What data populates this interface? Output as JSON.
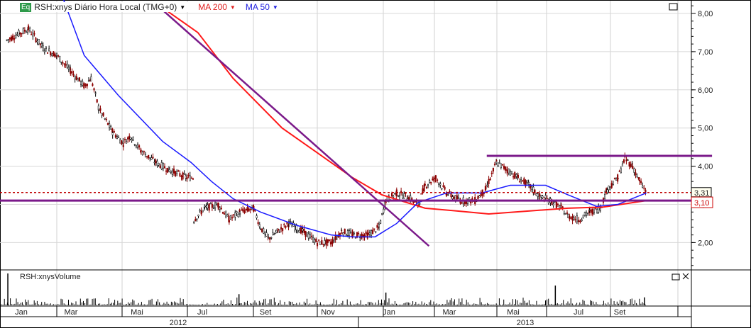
{
  "legend": {
    "badge": "Eq",
    "title": "RSH:xnys Diário Hora Local (TMG+0)",
    "ma200": "MA 200",
    "ma50": "MA 50",
    "dropdown_icon": "triangle-down"
  },
  "volume_panel": {
    "title": "RSH:xnysVolume"
  },
  "colors": {
    "ma200": "#ff1a1a",
    "ma50": "#1a1aff",
    "trendline": "#7b1a8a",
    "last_price": "#c00000",
    "candle_up": "#000000",
    "candle_down": "#8b0000"
  },
  "chart_data": {
    "type": "candlestick",
    "ylim": [
      1.3,
      8.35
    ],
    "yticks": [
      "8,00",
      "7,00",
      "6,00",
      "5,00",
      "4,00",
      "3,00",
      "2,00"
    ],
    "ytick_values": [
      8,
      7,
      6,
      5,
      4,
      3,
      2
    ],
    "months": [
      "Jan",
      "Mar",
      "Mai",
      "Jul",
      "Set",
      "Nov",
      "Jan",
      "Mar",
      "Mai",
      "Jul",
      "Set"
    ],
    "years": [
      "2012",
      "2013"
    ],
    "price": [
      [
        "2012-01-08",
        7.3
      ],
      [
        "2012-01-30",
        7.6
      ],
      [
        "2012-02-14",
        7.1
      ],
      [
        "2012-02-28",
        6.9
      ],
      [
        "2012-03-13",
        6.5
      ],
      [
        "2012-03-27",
        6.1
      ],
      [
        "2012-04-03",
        6.3
      ],
      [
        "2012-04-11",
        5.5
      ],
      [
        "2012-04-25",
        4.9
      ],
      [
        "2012-05-06",
        4.6
      ],
      [
        "2012-05-13",
        4.8
      ],
      [
        "2012-05-24",
        4.4
      ],
      [
        "2012-06-08",
        4.1
      ],
      [
        "2012-06-22",
        3.9
      ],
      [
        "2012-07-10",
        3.7
      ],
      [
        "2012-07-17",
        2.6
      ],
      [
        "2012-07-28",
        2.9
      ],
      [
        "2012-08-11",
        3.0
      ],
      [
        "2012-08-22",
        2.6
      ],
      [
        "2012-09-02",
        2.8
      ],
      [
        "2012-09-16",
        2.9
      ],
      [
        "2012-09-23",
        2.4
      ],
      [
        "2012-10-01",
        2.1
      ],
      [
        "2012-10-11",
        2.3
      ],
      [
        "2012-10-22",
        2.5
      ],
      [
        "2012-11-05",
        2.3
      ],
      [
        "2012-11-20",
        2.0
      ],
      [
        "2012-12-04",
        2.0
      ],
      [
        "2012-12-15",
        2.3
      ],
      [
        "2012-12-26",
        2.2
      ],
      [
        "2013-01-11",
        2.2
      ],
      [
        "2013-01-22",
        2.4
      ],
      [
        "2013-01-29",
        3.1
      ],
      [
        "2013-02-09",
        3.3
      ],
      [
        "2013-02-20",
        3.2
      ],
      [
        "2013-03-03",
        3.0
      ],
      [
        "2013-03-10",
        3.5
      ],
      [
        "2013-03-21",
        3.7
      ],
      [
        "2013-04-01",
        3.3
      ],
      [
        "2013-04-15",
        3.1
      ],
      [
        "2013-04-30",
        3.1
      ],
      [
        "2013-05-11",
        3.4
      ],
      [
        "2013-05-22",
        4.1
      ],
      [
        "2013-06-02",
        3.9
      ],
      [
        "2013-06-13",
        3.7
      ],
      [
        "2013-06-24",
        3.5
      ],
      [
        "2013-07-05",
        3.2
      ],
      [
        "2013-07-16",
        3.1
      ],
      [
        "2013-07-27",
        2.9
      ],
      [
        "2013-08-03",
        2.7
      ],
      [
        "2013-08-14",
        2.6
      ],
      [
        "2013-08-25",
        2.8
      ],
      [
        "2013-09-05",
        2.9
      ],
      [
        "2013-09-12",
        3.4
      ],
      [
        "2013-09-23",
        3.7
      ],
      [
        "2013-09-30",
        4.2
      ],
      [
        "2013-10-08",
        4.0
      ],
      [
        "2013-10-15",
        3.6
      ],
      [
        "2013-10-22",
        3.31
      ]
    ],
    "ma50": [
      [
        "2012-03-06",
        8.35
      ],
      [
        "2012-03-27",
        6.9
      ],
      [
        "2012-05-01",
        5.85
      ],
      [
        "2012-06-15",
        4.65
      ],
      [
        "2012-07-14",
        4.1
      ],
      [
        "2012-08-04",
        3.6
      ],
      [
        "2012-08-26",
        3.15
      ],
      [
        "2012-09-23",
        2.8
      ],
      [
        "2012-10-30",
        2.45
      ],
      [
        "2012-12-04",
        2.2
      ],
      [
        "2012-12-26",
        2.15
      ],
      [
        "2013-01-18",
        2.15
      ],
      [
        "2013-02-09",
        2.5
      ],
      [
        "2013-03-03",
        3.05
      ],
      [
        "2013-04-01",
        3.3
      ],
      [
        "2013-05-07",
        3.3
      ],
      [
        "2013-06-05",
        3.5
      ],
      [
        "2013-07-11",
        3.5
      ],
      [
        "2013-08-03",
        3.25
      ],
      [
        "2013-09-01",
        2.95
      ],
      [
        "2013-09-23",
        3.0
      ],
      [
        "2013-10-22",
        3.3
      ]
    ],
    "ma200": [
      [
        "2012-06-15",
        8.15
      ],
      [
        "2012-07-21",
        7.5
      ],
      [
        "2012-08-26",
        6.3
      ],
      [
        "2012-10-15",
        5.0
      ],
      [
        "2012-11-20",
        4.35
      ],
      [
        "2012-12-26",
        3.7
      ],
      [
        "2013-01-25",
        3.25
      ],
      [
        "2013-03-10",
        2.9
      ],
      [
        "2013-04-15",
        2.82
      ],
      [
        "2013-05-14",
        2.75
      ],
      [
        "2013-06-20",
        2.82
      ],
      [
        "2013-08-03",
        2.9
      ],
      [
        "2013-09-08",
        2.93
      ],
      [
        "2013-10-22",
        3.1
      ]
    ],
    "trendline": [
      [
        "2012-06-15",
        8.09
      ],
      [
        "2013-03-14",
        1.91
      ]
    ],
    "resistance": {
      "value": 4.27,
      "from": "2013-05-12",
      "to": "2013-12-28"
    },
    "support": {
      "value": 3.1,
      "label": "3,10"
    },
    "last_price": {
      "value": 3.31,
      "label": "3,31"
    },
    "volume_spikes": [
      [
        "2012-01-09",
        1.0
      ],
      [
        "2013-07-21",
        0.62
      ],
      [
        "2012-09-01",
        0.35
      ],
      [
        "2013-01-29",
        0.4
      ],
      [
        "2013-10-20",
        0.25
      ]
    ]
  }
}
